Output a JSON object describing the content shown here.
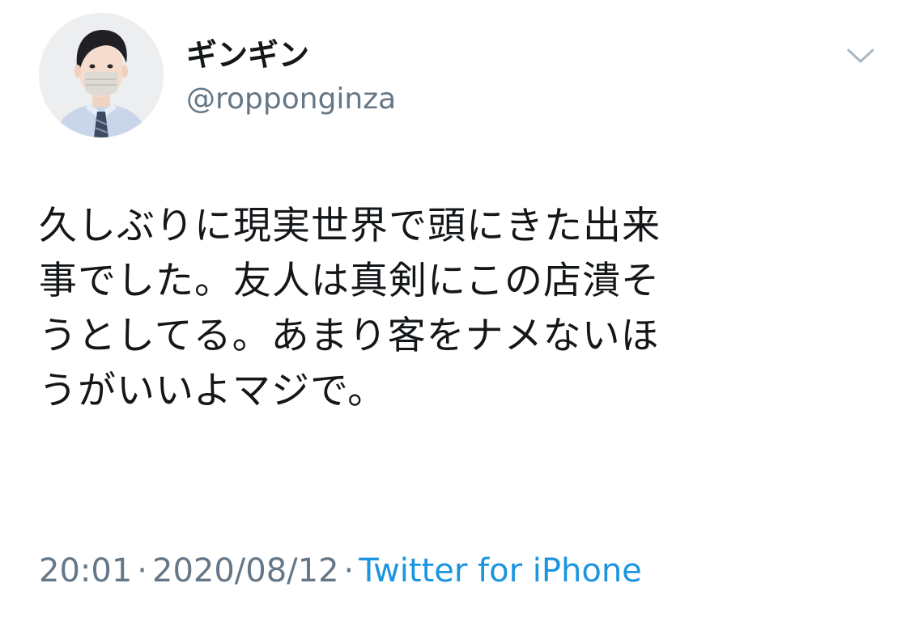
{
  "tweet": {
    "author": {
      "display_name": "ギンギン",
      "handle": "@ropponginza"
    },
    "text_lines": [
      "久しぶりに現実世界で頭にきた出来",
      "事でした。友人は真剣にこの店潰そ",
      "うとしてる。あまり客をナメないほ",
      "うがいいよマジで。"
    ],
    "time": "20:01",
    "separator": "·",
    "date": "2020/08/12",
    "source": "Twitter for iPhone"
  },
  "colors": {
    "text": "#14171a",
    "secondary": "#657786",
    "link": "#1b95e0",
    "caret": "#aab8c2"
  },
  "icons": {
    "more": "chevron-down-icon"
  }
}
